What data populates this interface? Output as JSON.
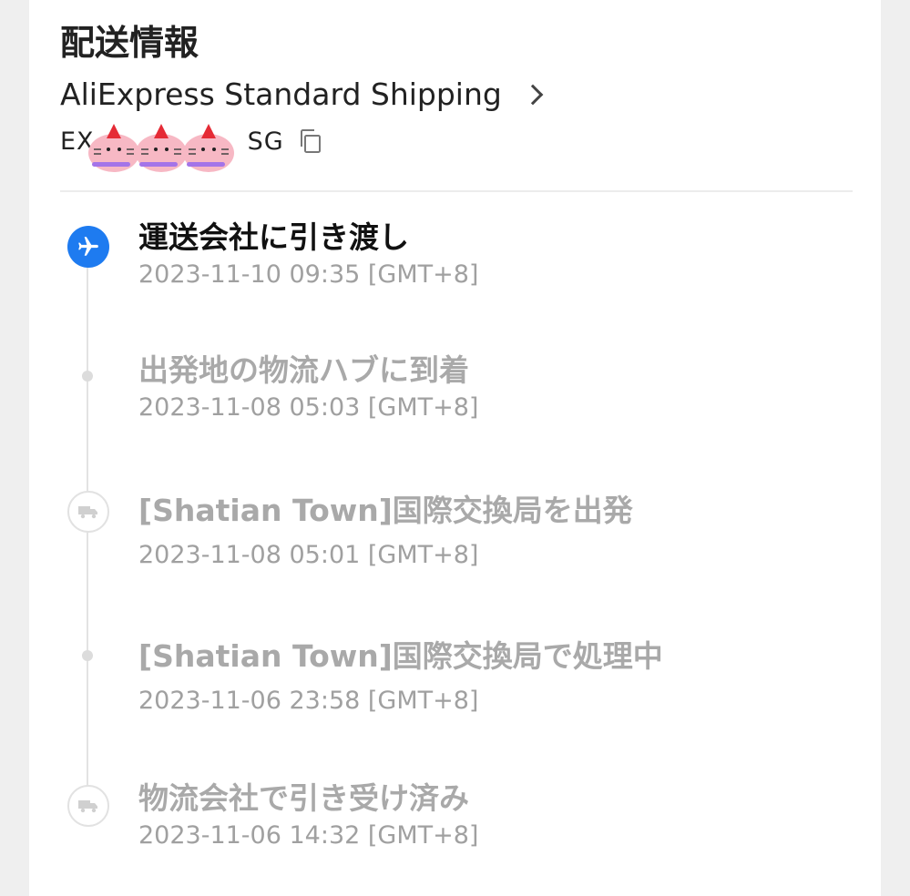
{
  "header": {
    "title": "配送情報"
  },
  "carrier": {
    "name": "AliExpress Standard Shipping"
  },
  "tracking": {
    "prefix": "EX",
    "suffix": "SG"
  },
  "colors": {
    "accent": "#1e7bf0",
    "active_text": "#111111",
    "inactive_text": "#a9a9a9",
    "timeline": "#e3e3e3"
  },
  "events": [
    {
      "title": "運送会社に引き渡し",
      "time": "2023-11-10 09:35 [GMT+8]",
      "icon": "airplane-icon",
      "status": "active"
    },
    {
      "title": "出発地の物流ハブに到着",
      "time": "2023-11-08 05:03 [GMT+8]",
      "icon": "dot",
      "status": "past"
    },
    {
      "title": "[Shatian Town]国際交換局を出発",
      "time": "2023-11-08 05:01 [GMT+8]",
      "icon": "truck-icon",
      "status": "past"
    },
    {
      "title": "[Shatian Town]国際交換局で処理中",
      "time": "2023-11-06 23:58 [GMT+8]",
      "icon": "dot",
      "status": "past"
    },
    {
      "title": "物流会社で引き受け済み",
      "time": "2023-11-06 14:32 [GMT+8]",
      "icon": "truck-icon",
      "status": "past"
    }
  ]
}
